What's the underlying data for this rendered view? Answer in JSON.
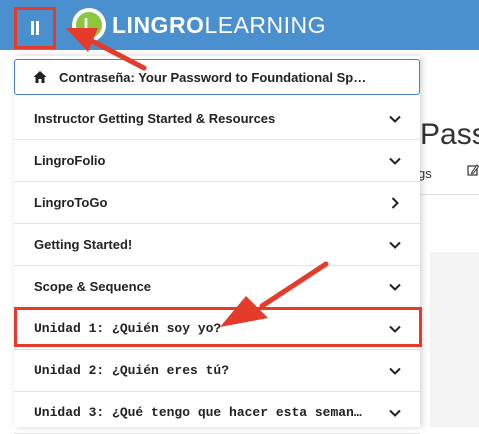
{
  "header": {
    "brand_bold": "LINGRO",
    "brand_light": "LEARNING",
    "logo_letter": "L",
    "bg_color": "#4a90cf"
  },
  "background_page": {
    "title_fragment": "Pass",
    "tab_fragment": "gs",
    "edit_icon": "pencil-icon"
  },
  "menu": {
    "home_item": "Contraseña: Your Password to Foundational Sp…",
    "items": [
      {
        "label": "Instructor Getting Started & Resources",
        "chevron": "down"
      },
      {
        "label": "LingroFolio",
        "chevron": "down"
      },
      {
        "label": "LingroToGo",
        "chevron": "right"
      },
      {
        "label": "Getting Started!",
        "chevron": "down"
      },
      {
        "label": "Scope & Sequence",
        "chevron": "down"
      },
      {
        "label": "Unidad 1: ¿Quién soy yo?",
        "chevron": "down"
      },
      {
        "label": "Unidad 2: ¿Quién eres tú?",
        "chevron": "down"
      },
      {
        "label": "Unidad 3: ¿Qué tengo que hacer esta seman…",
        "chevron": "down"
      }
    ]
  },
  "annotation": {
    "color": "#e53b2a"
  }
}
